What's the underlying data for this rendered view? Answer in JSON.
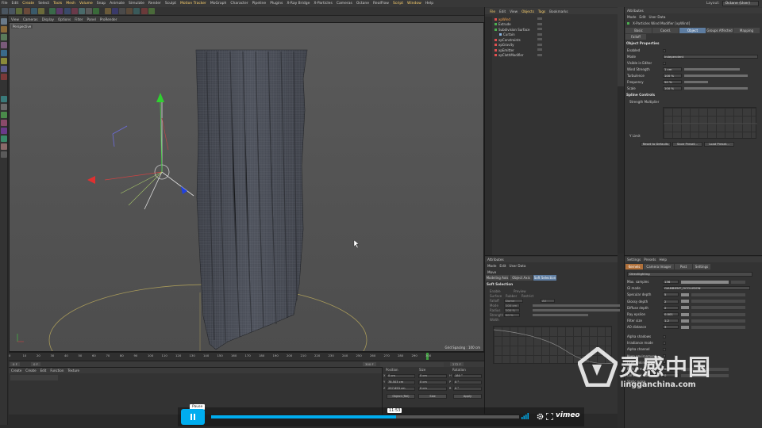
{
  "menubar": {
    "items": [
      "File",
      "Edit",
      "Create",
      "Select",
      "Tools",
      "Mesh",
      "Volume",
      "Snap",
      "Animate",
      "Simulate",
      "Render",
      "Sculpt",
      "Motion Tracker",
      "MoGraph",
      "Character",
      "Pipeline",
      "Plugins",
      "X-Ray Bridge",
      "X-Particles",
      "Cameras",
      "Octane",
      "RealFlow",
      "Script",
      "Window",
      "Help"
    ],
    "highlighted": [
      "Create",
      "Tools",
      "Mesh",
      "Volume",
      "Motion Tracker",
      "Script",
      "Window"
    ],
    "layout_label": "Layout:",
    "layout_value": "Octane (User)"
  },
  "viewport": {
    "menu": [
      "View",
      "Cameras",
      "Display",
      "Options",
      "Filter",
      "Panel",
      "ProRender"
    ],
    "name": "Perspective",
    "grid_spacing": "Grid Spacing : 100 cm"
  },
  "timeline": {
    "ticks": [
      "0",
      "10",
      "20",
      "30",
      "40",
      "50",
      "60",
      "70",
      "80",
      "90",
      "100",
      "110",
      "120",
      "130",
      "140",
      "150",
      "160",
      "170",
      "180",
      "190",
      "200",
      "210",
      "220",
      "230",
      "240",
      "250",
      "260",
      "270",
      "280",
      "290",
      "300"
    ],
    "start_field": "0 F",
    "end_field": "300 F",
    "current": "0 F",
    "frame_field": "0 F",
    "frame_count": "272 F"
  },
  "material_panel": {
    "menu": [
      "Create",
      "Create",
      "Edit",
      "Function",
      "Texture"
    ]
  },
  "coord_panel": {
    "headers": [
      "Position",
      "Size",
      "Rotation"
    ],
    "rows": [
      {
        "axis": "X",
        "pos": "0 cm",
        "size": "0 cm",
        "rot": "H",
        "rot_val": "180 °"
      },
      {
        "axis": "Y",
        "pos": "78.503 cm",
        "size": "0 cm",
        "rot": "P",
        "rot_val": "0 °"
      },
      {
        "axis": "Z",
        "pos": "297.693 cm",
        "size": "0 cm",
        "rot": "B",
        "rot_val": "0 °"
      }
    ],
    "mode": "Object (Rel)",
    "size_mode": "Size",
    "apply": "Apply"
  },
  "objects": {
    "menu": [
      "File",
      "Edit",
      "View",
      "Objects",
      "Tags",
      "Bookmarks"
    ],
    "highlighted": [
      "File",
      "Objects",
      "Tags"
    ],
    "rows": [
      "xpWind",
      "Extrude",
      "Subdivision Surface",
      "Curtain",
      "xpConstraints",
      "xpGravity",
      "xpEmitter",
      "xpClothModifier"
    ],
    "selected": "xpWind"
  },
  "attributes": {
    "title": "Attributes",
    "menu": [
      "Mode",
      "Edit",
      "User Data"
    ],
    "object_title": "X-Particles Wind Modifier [xpWind]",
    "tabs": [
      "Basic",
      "Coord.",
      "Object",
      "Groups Affected",
      "Mapping",
      "Falloff"
    ],
    "active_tab": "Object",
    "section": "Object Properties",
    "props": [
      {
        "label": "Enabled",
        "value": ""
      },
      {
        "label": "Mode",
        "value": "Independent"
      },
      {
        "label": "Visible in Editor",
        "value": ""
      },
      {
        "label": "Wind Strength",
        "value": "1 cm"
      },
      {
        "label": "Turbulence",
        "value": "100 %"
      },
      {
        "label": "Frequency",
        "value": "50 %"
      },
      {
        "label": "Scale",
        "value": "100 %"
      }
    ],
    "spline_section": "Spline Controls",
    "spline_label": "Strength Multiplier",
    "y_limit": "Y Limit",
    "buttons": [
      "Reset to Defaults",
      "Save Preset...",
      "Load Preset..."
    ]
  },
  "attributes2": {
    "title": "Attributes",
    "menu": [
      "Mode",
      "Edit",
      "User Data"
    ],
    "object": "Move",
    "tabs": [
      "Modeling Axis",
      "Object Axis",
      "Soft Selection"
    ],
    "active_tab": "Soft Selection",
    "section": "Soft Selection",
    "props": [
      "Enable",
      "Preview",
      "Surface",
      "Rubber",
      "Restrict",
      "Falloff",
      "Mode",
      "Radius",
      "Strength",
      "Width"
    ],
    "falloff_value": "Dome",
    "mode_value": "All",
    "radius": "100 cm",
    "strength": "100 %",
    "width": "50 %"
  },
  "render": {
    "menu": [
      "Settings",
      "Presets",
      "Help"
    ],
    "tabs": [
      "Kernels",
      "Camera Imager",
      "Post",
      "Settings"
    ],
    "kernel": "Directlighting",
    "props": [
      {
        "label": "Max. samples",
        "value": "136"
      },
      {
        "label": "GI mode",
        "value": "GIAMBIENT_OCCLUSION"
      },
      {
        "label": "Specular depth",
        "value": "5"
      },
      {
        "label": "Glossy depth",
        "value": "2"
      },
      {
        "label": "Diffuse depth",
        "value": "2"
      },
      {
        "label": "Ray epsilon",
        "value": "0.001"
      },
      {
        "label": "Filter size",
        "value": "1.2"
      },
      {
        "label": "AO distance",
        "value": "3"
      }
    ],
    "bottom": [
      {
        "label": "Alpha shadows",
        "value": ""
      },
      {
        "label": "Irradiance mode",
        "value": ""
      },
      {
        "label": "Alpha channel",
        "value": ""
      },
      {
        "label": "Keep environment",
        "value": ""
      },
      {
        "label": "Light linking invert",
        "value": ""
      },
      {
        "label": "Path term. power",
        "value": "0.3"
      },
      {
        "label": "Coherent ratio",
        "value": "0"
      },
      {
        "label": "Static noise",
        "value": ""
      }
    ]
  },
  "player": {
    "tooltip": "Pause",
    "time": "11:53",
    "progress": 0.6,
    "logo": "vimeo"
  },
  "watermark": {
    "text": "灵感中国",
    "sub": "lingganchina.com"
  },
  "colors": {
    "accent": "#00adef",
    "selection": "#ffa850",
    "menu_highlight": "#ffd36e",
    "tab_active": "#5e7da1"
  }
}
